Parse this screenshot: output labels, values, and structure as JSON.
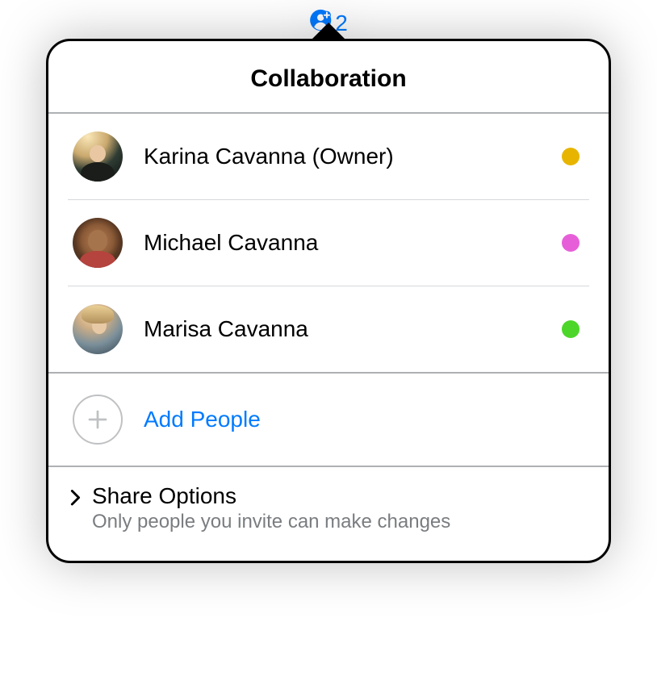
{
  "badge_count": "2",
  "title": "Collaboration",
  "people": [
    {
      "name": "Karina Cavanna (Owner)",
      "color": "#e7b500"
    },
    {
      "name": "Michael Cavanna",
      "color": "#e75fd8"
    },
    {
      "name": "Marisa Cavanna",
      "color": "#4cd62a"
    }
  ],
  "add_label": "Add People",
  "share": {
    "title": "Share Options",
    "subtitle": "Only people you invite can make changes"
  }
}
